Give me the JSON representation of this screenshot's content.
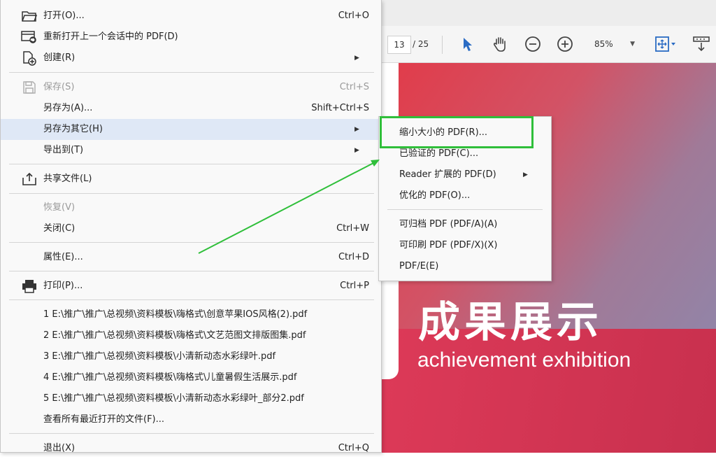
{
  "toolbar": {
    "page_current": "13",
    "page_total": "/ 25",
    "zoom": "85%",
    "icons": [
      "select-tool-icon",
      "hand-tool-icon",
      "zoom-out-icon",
      "zoom-in-icon",
      "zoom-dropdown-icon",
      "page-view-icon",
      "scroll-mode-icon"
    ]
  },
  "document": {
    "title": "成果展示",
    "subtitle": "achievement exhibition"
  },
  "file_menu": {
    "open": {
      "label": "打开(O)...",
      "shortcut": "Ctrl+O"
    },
    "reopen_session": {
      "label": "重新打开上一个会话中的 PDF(D)"
    },
    "create": {
      "label": "创建(R)"
    },
    "save": {
      "label": "保存(S)",
      "shortcut": "Ctrl+S"
    },
    "save_as": {
      "label": "另存为(A)...",
      "shortcut": "Shift+Ctrl+S"
    },
    "save_as_other": {
      "label": "另存为其它(H)"
    },
    "export_to": {
      "label": "导出到(T)"
    },
    "share_file": {
      "label": "共享文件(L)"
    },
    "revert": {
      "label": "恢复(V)"
    },
    "close": {
      "label": "关闭(C)",
      "shortcut": "Ctrl+W"
    },
    "properties": {
      "label": "属性(E)...",
      "shortcut": "Ctrl+D"
    },
    "print": {
      "label": "打印(P)...",
      "shortcut": "Ctrl+P"
    },
    "recent": [
      "1 E:\\推广\\推广\\总视频\\资料模板\\嗨格式\\创意苹果IOS风格(2).pdf",
      "2 E:\\推广\\推广\\总视频\\资料模板\\嗨格式\\文艺范图文排版图集.pdf",
      "3 E:\\推广\\推广\\总视频\\资料模板\\小清新动态水彩绿叶.pdf",
      "4 E:\\推广\\推广\\总视频\\资料模板\\嗨格式\\儿童暑假生活展示.pdf",
      "5 E:\\推广\\推广\\总视频\\资料模板\\小清新动态水彩绿叶_部分2.pdf"
    ],
    "view_all_recent": {
      "label": "查看所有最近打开的文件(F)..."
    },
    "exit": {
      "label": "退出(X)",
      "shortcut": "Ctrl+Q"
    }
  },
  "submenu": {
    "reduced_size": "缩小大小的 PDF(R)...",
    "certified": "已验证的 PDF(C)...",
    "reader_extended": "Reader 扩展的 PDF(D)",
    "optimized": "优化的 PDF(O)...",
    "archivable": "可归档 PDF (PDF/A)(A)",
    "printable": "可印刷 PDF (PDF/X)(X)",
    "pdf_e": "PDF/E(E)"
  },
  "colors": {
    "highlight_box": "#2fbf3a",
    "arrow": "#2fbf3a",
    "menu_highlight": "#dfe8f6",
    "accent_blue": "#2b6cc4"
  }
}
